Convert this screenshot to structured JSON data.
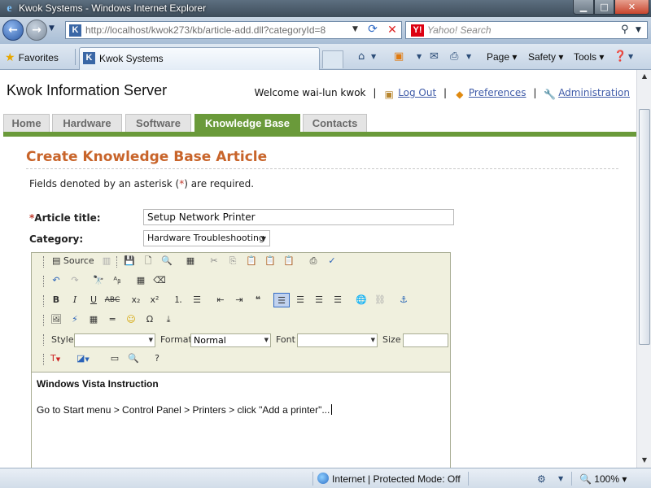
{
  "browser": {
    "window_title": "Kwok Systems - Windows Internet Explorer",
    "url": "http://localhost/kwok273/kb/article-add.dll?categoryId=8",
    "search_placeholder": "Yahoo! Search",
    "favorites_label": "Favorites",
    "tab_title": "Kwok Systems",
    "commands": {
      "page": "Page",
      "safety": "Safety",
      "tools": "Tools"
    },
    "status_zone": "Internet | Protected Mode: Off",
    "zoom": "100%"
  },
  "site": {
    "title": "Kwok Information Server",
    "welcome": "Welcome wai-lun kwok",
    "links": {
      "logout": "Log Out",
      "preferences": "Preferences",
      "administration": "Administration"
    },
    "nav": [
      {
        "label": "Home",
        "active": false
      },
      {
        "label": "Hardware",
        "active": false
      },
      {
        "label": "Software",
        "active": false
      },
      {
        "label": "Knowledge Base",
        "active": true
      },
      {
        "label": "Contacts",
        "active": false
      }
    ]
  },
  "form": {
    "heading": "Create Knowledge Base Article",
    "required_note_pre": "Fields denoted by an asterisk (",
    "required_note_ast": "*",
    "required_note_post": ") are required.",
    "title_label": "Article title:",
    "title_value": "Setup Network Printer",
    "category_label": "Category:",
    "category_value": "Hardware Troubleshooting"
  },
  "editor": {
    "source_label": "Source",
    "style_label": "Style",
    "style_value": "",
    "format_label": "Format",
    "format_value": "Normal",
    "font_label": "Font",
    "font_value": "",
    "size_label": "Size",
    "size_value": "",
    "content_heading": "Windows Vista Instruction",
    "content_body": "Go to Start menu > Control Panel > Printers > click \"Add a printer\"..."
  },
  "colors": {
    "accent_green": "#6a9a3a",
    "heading_orange": "#c8642a",
    "link_blue": "#3f5ba8"
  }
}
